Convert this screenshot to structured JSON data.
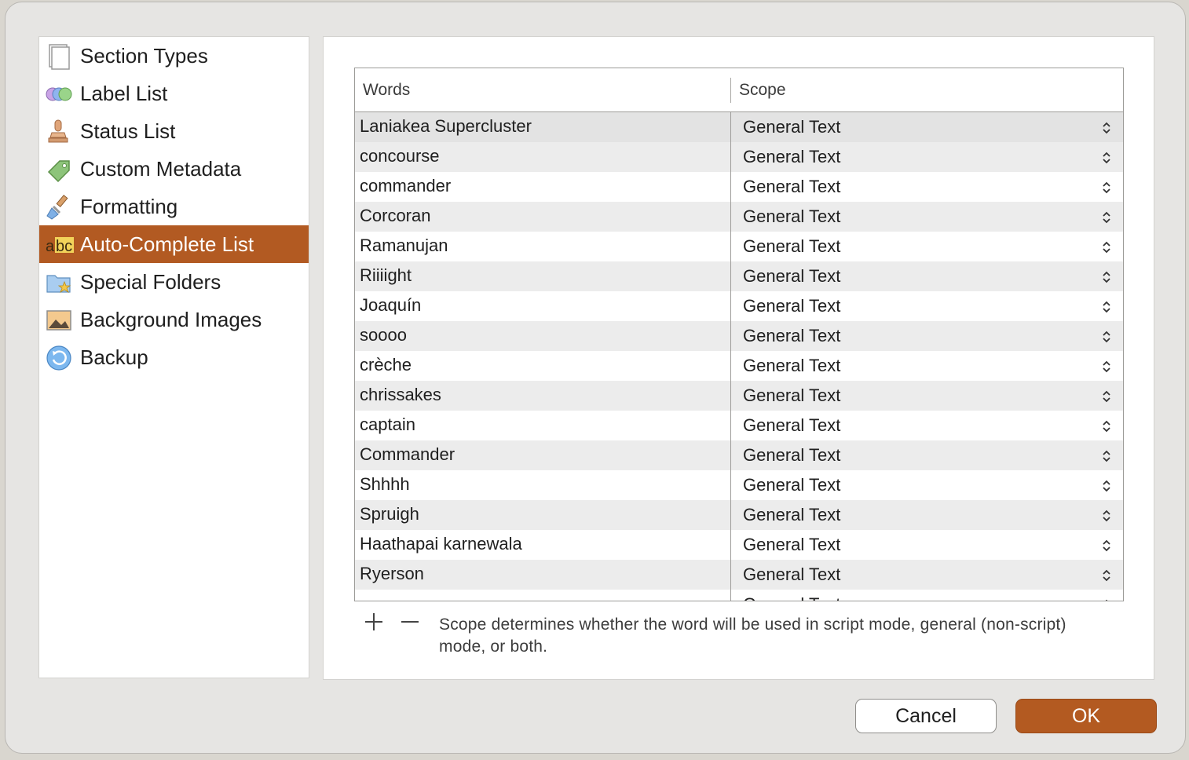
{
  "sidebar": {
    "items": [
      {
        "label": "Section Types",
        "icon": "section-types-icon"
      },
      {
        "label": "Label List",
        "icon": "label-list-icon"
      },
      {
        "label": "Status List",
        "icon": "status-stamp-icon"
      },
      {
        "label": "Custom Metadata",
        "icon": "tag-icon"
      },
      {
        "label": "Formatting",
        "icon": "paintbrush-icon"
      },
      {
        "label": "Auto-Complete List",
        "icon": "abc-icon",
        "selected": true
      },
      {
        "label": "Special Folders",
        "icon": "folder-star-icon"
      },
      {
        "label": "Background Images",
        "icon": "image-icon"
      },
      {
        "label": "Backup",
        "icon": "backup-icon"
      }
    ]
  },
  "table": {
    "headers": {
      "words": "Words",
      "scope": "Scope"
    },
    "rows": [
      {
        "word": "Laniakea Supercluster",
        "scope": "General Text"
      },
      {
        "word": "concourse",
        "scope": "General Text"
      },
      {
        "word": "commander",
        "scope": "General Text"
      },
      {
        "word": "Corcoran",
        "scope": "General Text"
      },
      {
        "word": "Ramanujan",
        "scope": "General Text"
      },
      {
        "word": "Riiiight",
        "scope": "General Text"
      },
      {
        "word": "Joaquín",
        "scope": "General Text"
      },
      {
        "word": "soooo",
        "scope": "General Text"
      },
      {
        "word": "crèche",
        "scope": "General Text"
      },
      {
        "word": "chrissakes",
        "scope": "General Text"
      },
      {
        "word": "captain",
        "scope": "General Text"
      },
      {
        "word": "Commander",
        "scope": "General Text"
      },
      {
        "word": "Shhhh",
        "scope": "General Text"
      },
      {
        "word": "Spruigh",
        "scope": "General Text"
      },
      {
        "word": "Haathapai karnewala",
        "scope": "General Text"
      },
      {
        "word": "Ryerson",
        "scope": "General Text"
      },
      {
        "word": "",
        "scope": "General Text"
      }
    ]
  },
  "footer": {
    "add_symbol": "+",
    "remove_symbol": "−",
    "note": "Scope determines whether the word will be used in script mode, general (non-script) mode, or both."
  },
  "buttons": {
    "cancel": "Cancel",
    "ok": "OK"
  },
  "colors": {
    "accent": "#b25a22",
    "ok_button": "#b35a21"
  }
}
